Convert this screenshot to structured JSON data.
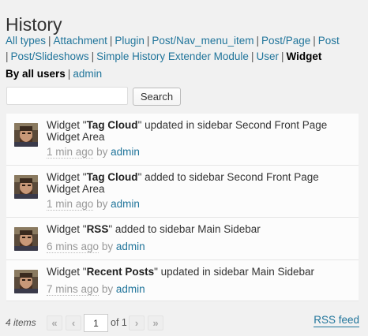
{
  "page": {
    "title": "History"
  },
  "filters": {
    "types": [
      "All types",
      "Attachment",
      "Plugin",
      "Post/Nav_menu_item",
      "Post/Page",
      "Post",
      "Post/Slideshows",
      "Simple History Extender Module",
      "User",
      "Widget"
    ],
    "current_type": "Widget",
    "users": [
      "By all users",
      "admin"
    ],
    "current_user": "By all users"
  },
  "search": {
    "value": "",
    "placeholder": "",
    "button_label": "Search"
  },
  "items": [
    {
      "prefix": "Widget \"",
      "name": "Tag Cloud",
      "suffix": "\" updated in sidebar Second Front Page Widget Area",
      "when": "1 min ago",
      "by": "by",
      "user": "admin"
    },
    {
      "prefix": "Widget \"",
      "name": "Tag Cloud",
      "suffix": "\" added to sidebar Second Front Page Widget Area",
      "when": "1 min ago",
      "by": "by",
      "user": "admin"
    },
    {
      "prefix": "Widget \"",
      "name": "RSS",
      "suffix": "\" added to sidebar Main Sidebar",
      "when": "6 mins ago",
      "by": "by",
      "user": "admin"
    },
    {
      "prefix": "Widget \"",
      "name": "Recent Posts",
      "suffix": "\" updated in sidebar Main Sidebar",
      "when": "7 mins ago",
      "by": "by",
      "user": "admin"
    }
  ],
  "pagination": {
    "count": "4 items",
    "first": "«",
    "prev": "‹",
    "current": "1",
    "of_pages": "of 1",
    "next": "›",
    "last": "»",
    "rss_label": "RSS feed"
  },
  "colors": {
    "link": "#21759b",
    "background": "#f1f1f1",
    "row": "#fcfcfc"
  }
}
